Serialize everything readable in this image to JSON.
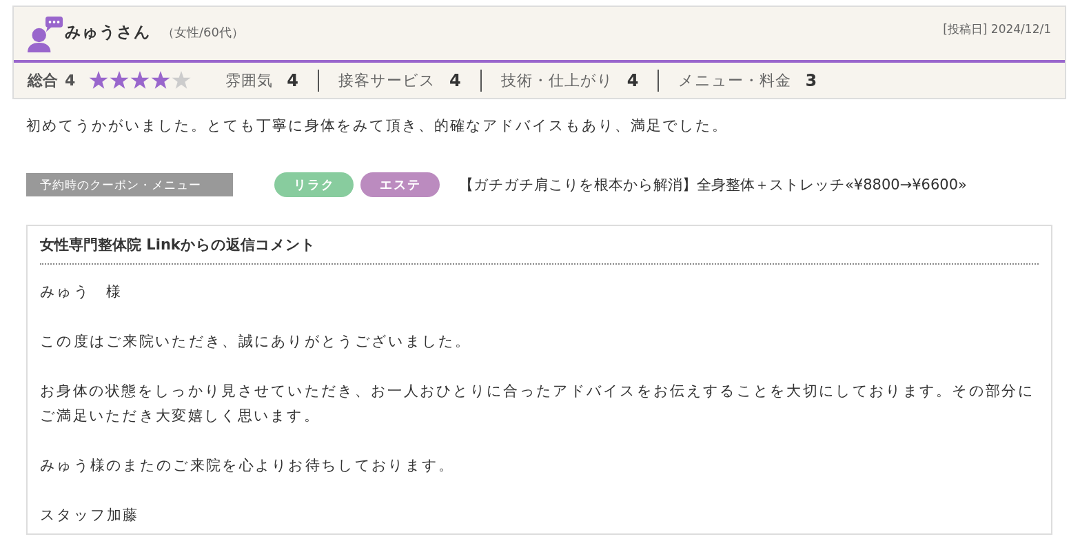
{
  "review": {
    "reviewer": {
      "name": "みゅうさん",
      "attributes": "（女性/60代）"
    },
    "posted": "[投稿日] 2024/12/1",
    "overall": {
      "label": "総合",
      "score": "4",
      "stars": 4
    },
    "ratings": [
      {
        "label": "雰囲気",
        "score": "4"
      },
      {
        "label": "接客サービス",
        "score": "4"
      },
      {
        "label": "技術・仕上がり",
        "score": "4"
      },
      {
        "label": "メニュー・料金",
        "score": "3"
      }
    ],
    "text": "初めてうかがいました。とても丁寧に身体をみて頂き、的確なアドバイスもあり、満足でした。"
  },
  "coupon": {
    "label": "予約時のクーポン・メニュー",
    "tags": [
      {
        "label": "リラク",
        "color": "#88cc9e"
      },
      {
        "label": "エステ",
        "color": "#bb8bbf"
      }
    ],
    "menu": "【ガチガチ肩こりを根本から解消】全身整体＋ストレッチ«¥8800→¥6600»"
  },
  "reply": {
    "title": "女性専門整体院 Linkからの返信コメント",
    "paragraphs": [
      "みゅう　様",
      "この度はご来院いただき、誠にありがとうございました。",
      "お身体の状態をしっかり見させていただき、お一人おひとりに合ったアドバイスをお伝えすることを大切にしております。その部分にご満足いただき大変嬉しく思います。",
      "みゅう様のまたのご来院を心よりお待ちしております。",
      "スタッフ加藤"
    ]
  }
}
